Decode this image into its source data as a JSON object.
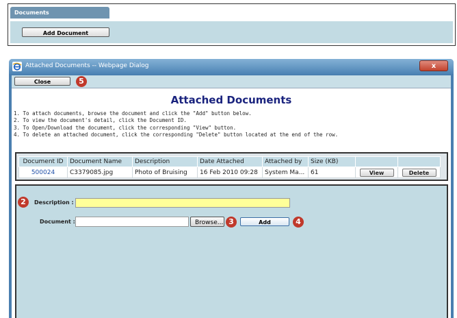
{
  "top": {
    "tab_label": "Documents",
    "add_button": "Add Document"
  },
  "dialog": {
    "window_title": "Attached Documents -- Webpage Dialog",
    "close_x": "x",
    "close_button": "Close",
    "heading": "Attached Documents",
    "instructions": [
      "1. To attach documents, browse the document and click the \"Add\" button below.",
      "2. To view the document's detail, click the Document ID.",
      "3. To Open/Download the document, click the corresponding \"View\" button.",
      "4. To delete an attached document, click the corresponding \"Delete\" button located at the end of the row."
    ]
  },
  "table": {
    "headers": [
      "Document ID",
      "Document Name",
      "Description",
      "Date Attached",
      "Attached by",
      "Size (KB)",
      "",
      ""
    ],
    "rows": [
      {
        "document_id": "500024",
        "document_name": "C3379085.jpg",
        "description": "Photo of Bruising",
        "date_attached": "16 Feb 2010 09:28",
        "attached_by": "System Ma...",
        "size_kb": "61",
        "view_label": "View",
        "delete_label": "Delete"
      }
    ]
  },
  "form": {
    "description_label": "Description :",
    "description_value": "",
    "document_label": "Document :",
    "document_value": "",
    "browse_label": "Browse...",
    "add_label": "Add"
  },
  "callouts": [
    "2",
    "3",
    "4",
    "5"
  ],
  "colors": {
    "callout": "#c0392b",
    "title_blue": "#1a237e",
    "panel": "#c2dbe3",
    "highlight_input": "#ffff99",
    "link": "#1f4fa8"
  }
}
